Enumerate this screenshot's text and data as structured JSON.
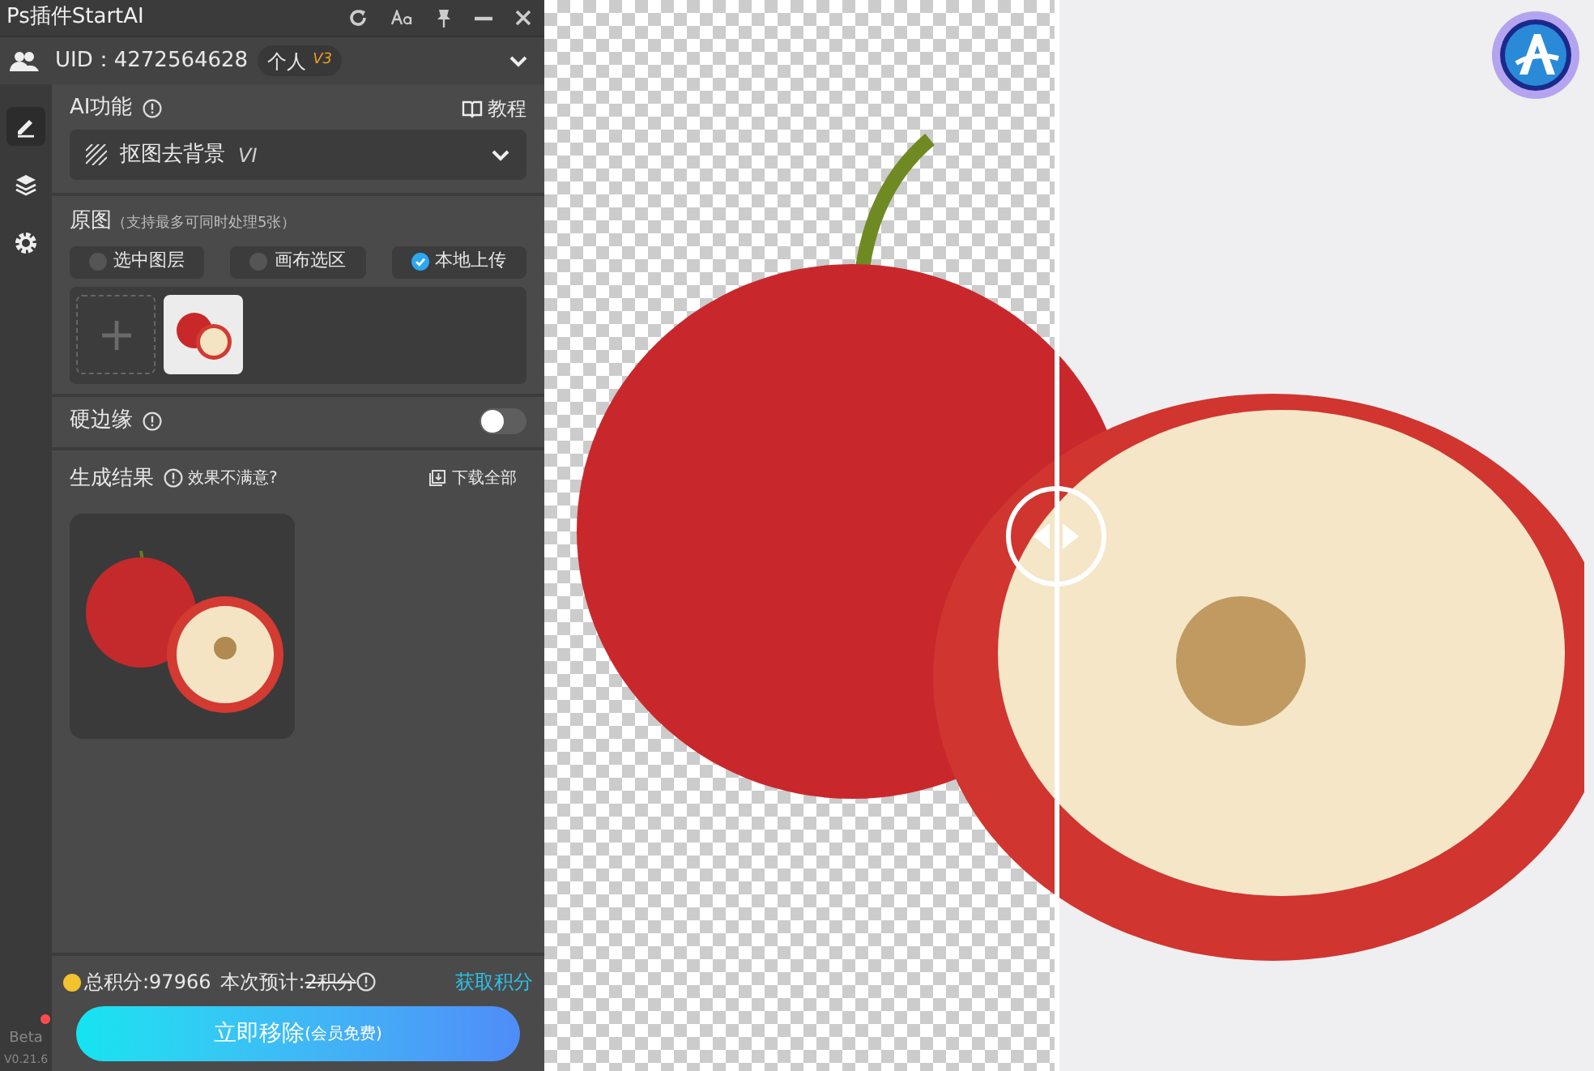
{
  "window": {
    "title": "Ps插件StartAI"
  },
  "account": {
    "uid": "UID：4272564628",
    "plan": "个人",
    "plan_level": "V3"
  },
  "sidebar": {
    "items": [
      {
        "kind": "edit",
        "selected": true
      },
      {
        "kind": "layers",
        "selected": false
      },
      {
        "kind": "settings",
        "selected": false
      }
    ],
    "beta": "Beta",
    "version": "V0.21.6"
  },
  "ai_function": {
    "label": "AI功能",
    "tutorial": "教程",
    "selected_value": "抠图去背景",
    "version_tag": "VI"
  },
  "source": {
    "label": "原图",
    "hint": "（支持最多可同时处理5张）",
    "options": [
      {
        "label": "选中图层",
        "selected": false
      },
      {
        "label": "画布选区",
        "selected": false
      },
      {
        "label": "本地上传",
        "selected": true
      }
    ]
  },
  "hard_edge": {
    "label": "硬边缘",
    "on": false
  },
  "results": {
    "label": "生成结果",
    "feedback": "效果不满意?",
    "download_all": "下载全部"
  },
  "footer": {
    "total_points": "总积分:97966",
    "estimate_label": "本次预计:",
    "estimate_value": "2积分",
    "estimate_struck": true,
    "get_points": "获取积分",
    "action_button": "立即移除",
    "action_note": "(会员免费)"
  }
}
